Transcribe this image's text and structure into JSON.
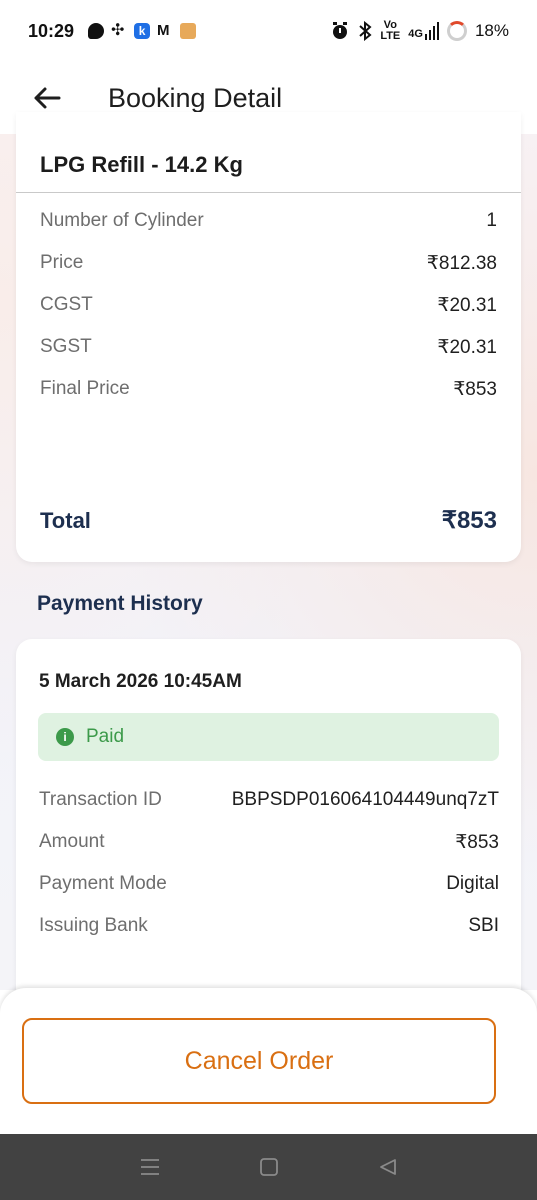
{
  "status_bar": {
    "time": "10:29",
    "battery": "18%",
    "signal_small_top": "Vo",
    "signal_small_bottom": "LTE",
    "network": "4G",
    "icons_left": [
      "chat-icon",
      "fan-icon",
      "k-app-icon",
      "gmail-icon",
      "box-icon"
    ],
    "icons_right": [
      "alarm-icon",
      "bluetooth-icon",
      "volte-icon",
      "signal-icon",
      "battery-icon"
    ]
  },
  "header": {
    "title": "Booking Detail"
  },
  "booking": {
    "product": "LPG Refill - 14.2 Kg",
    "rows": [
      {
        "label": "Number of Cylinder",
        "value": "1"
      },
      {
        "label": "Price",
        "value": "₹812.38"
      },
      {
        "label": "CGST",
        "value": "₹20.31"
      },
      {
        "label": "SGST",
        "value": "₹20.31"
      },
      {
        "label": "Final Price",
        "value": "₹853"
      }
    ],
    "total_label": "Total",
    "total_value": "₹853"
  },
  "payment_history": {
    "section_title": "Payment History",
    "date": "5 March 2026 10:45AM",
    "status": "Paid",
    "rows": [
      {
        "label": "Transaction ID",
        "value": "BBPSDP016064104449unq7zT"
      },
      {
        "label": "Amount",
        "value": "₹853"
      },
      {
        "label": "Payment Mode",
        "value": "Digital"
      },
      {
        "label": "Issuing Bank",
        "value": "SBI"
      }
    ]
  },
  "actions": {
    "cancel_label": "Cancel Order"
  },
  "colors": {
    "accent_orange": "#d96f12",
    "navy": "#1d2f4f",
    "paid_green": "#3c9a4a",
    "paid_bg": "#dff2e1"
  }
}
